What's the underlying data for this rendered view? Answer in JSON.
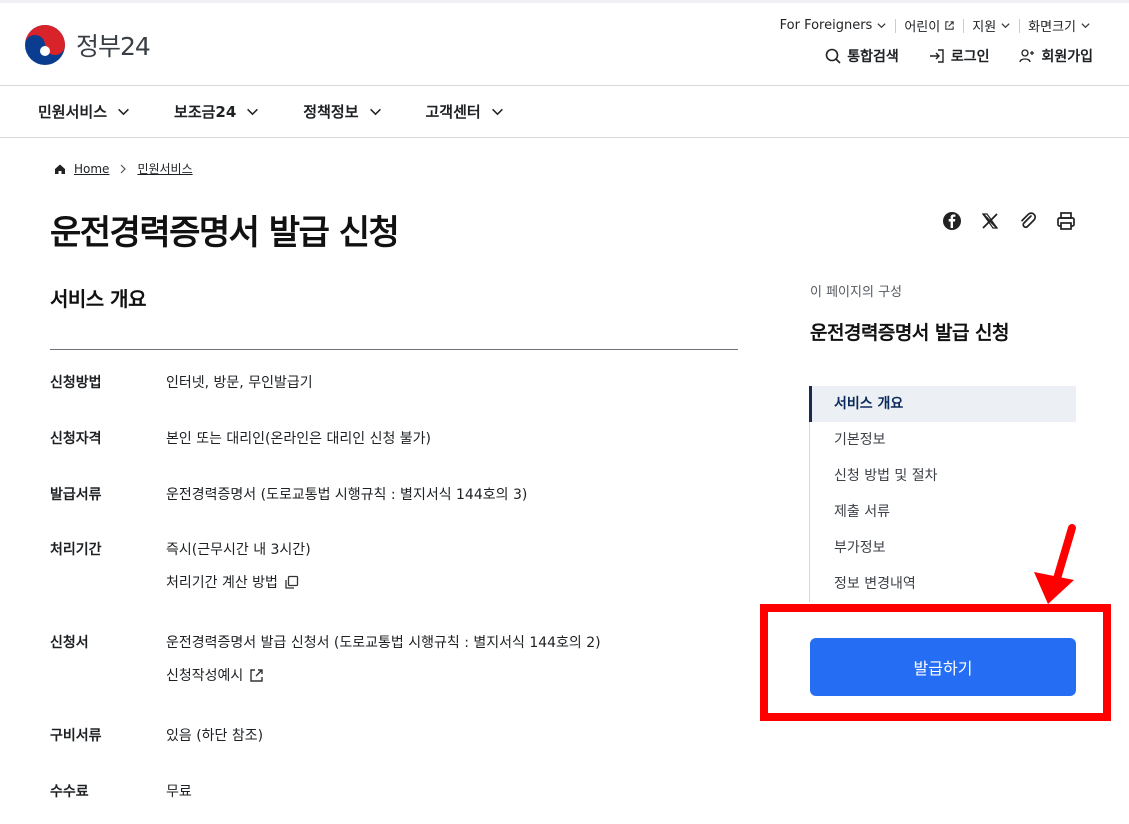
{
  "brand": {
    "name": "정부24"
  },
  "utility": [
    {
      "label": "For Foreigners",
      "icon": "chevron-down-icon"
    },
    {
      "label": "어린이",
      "icon": "external-link-icon"
    },
    {
      "label": "지원",
      "icon": "chevron-down-icon"
    },
    {
      "label": "화면크기",
      "icon": "chevron-down-icon"
    }
  ],
  "member": {
    "search": "통합검색",
    "login": "로그인",
    "signup": "회원가입"
  },
  "gnb": [
    "민원서비스",
    "보조금24",
    "정책정보",
    "고객센터"
  ],
  "breadcrumb": {
    "home": "Home",
    "current": "민원서비스"
  },
  "page_title": "운전경력증명서 발급 신청",
  "section": {
    "title": "서비스 개요",
    "rows": [
      {
        "key": "신청방법",
        "value": "인터넷, 방문, 무인발급기"
      },
      {
        "key": "신청자격",
        "value": "본인 또는 대리인(온라인은 대리인 신청 불가)"
      },
      {
        "key": "발급서류",
        "value": "운전경력증명서 (도로교통법 시행규칙 : 별지서식 144호의 3)"
      },
      {
        "key": "처리기간",
        "value": "즉시(근무시간 내 3시간)",
        "link": "처리기간 계산 방법"
      },
      {
        "key": "신청서",
        "value": "운전경력증명서 발급 신청서 (도로교통법 시행규칙 : 별지서식 144호의 2)",
        "link": "신청작성예시"
      },
      {
        "key": "구비서류",
        "value": "있음 (하단 참조)"
      },
      {
        "key": "수수료",
        "value": "무료"
      }
    ]
  },
  "toc": {
    "caption": "이 페이지의 구성",
    "title": "운전경력증명서 발급 신청",
    "items": [
      "서비스 개요",
      "기본정보",
      "신청 방법 및 절차",
      "제출 서류",
      "부가정보",
      "정보 변경내역"
    ]
  },
  "issue_button": "발급하기",
  "colors": {
    "primary": "#256ef4",
    "highlight": "#ff0000",
    "active_bg": "#eceff3"
  }
}
